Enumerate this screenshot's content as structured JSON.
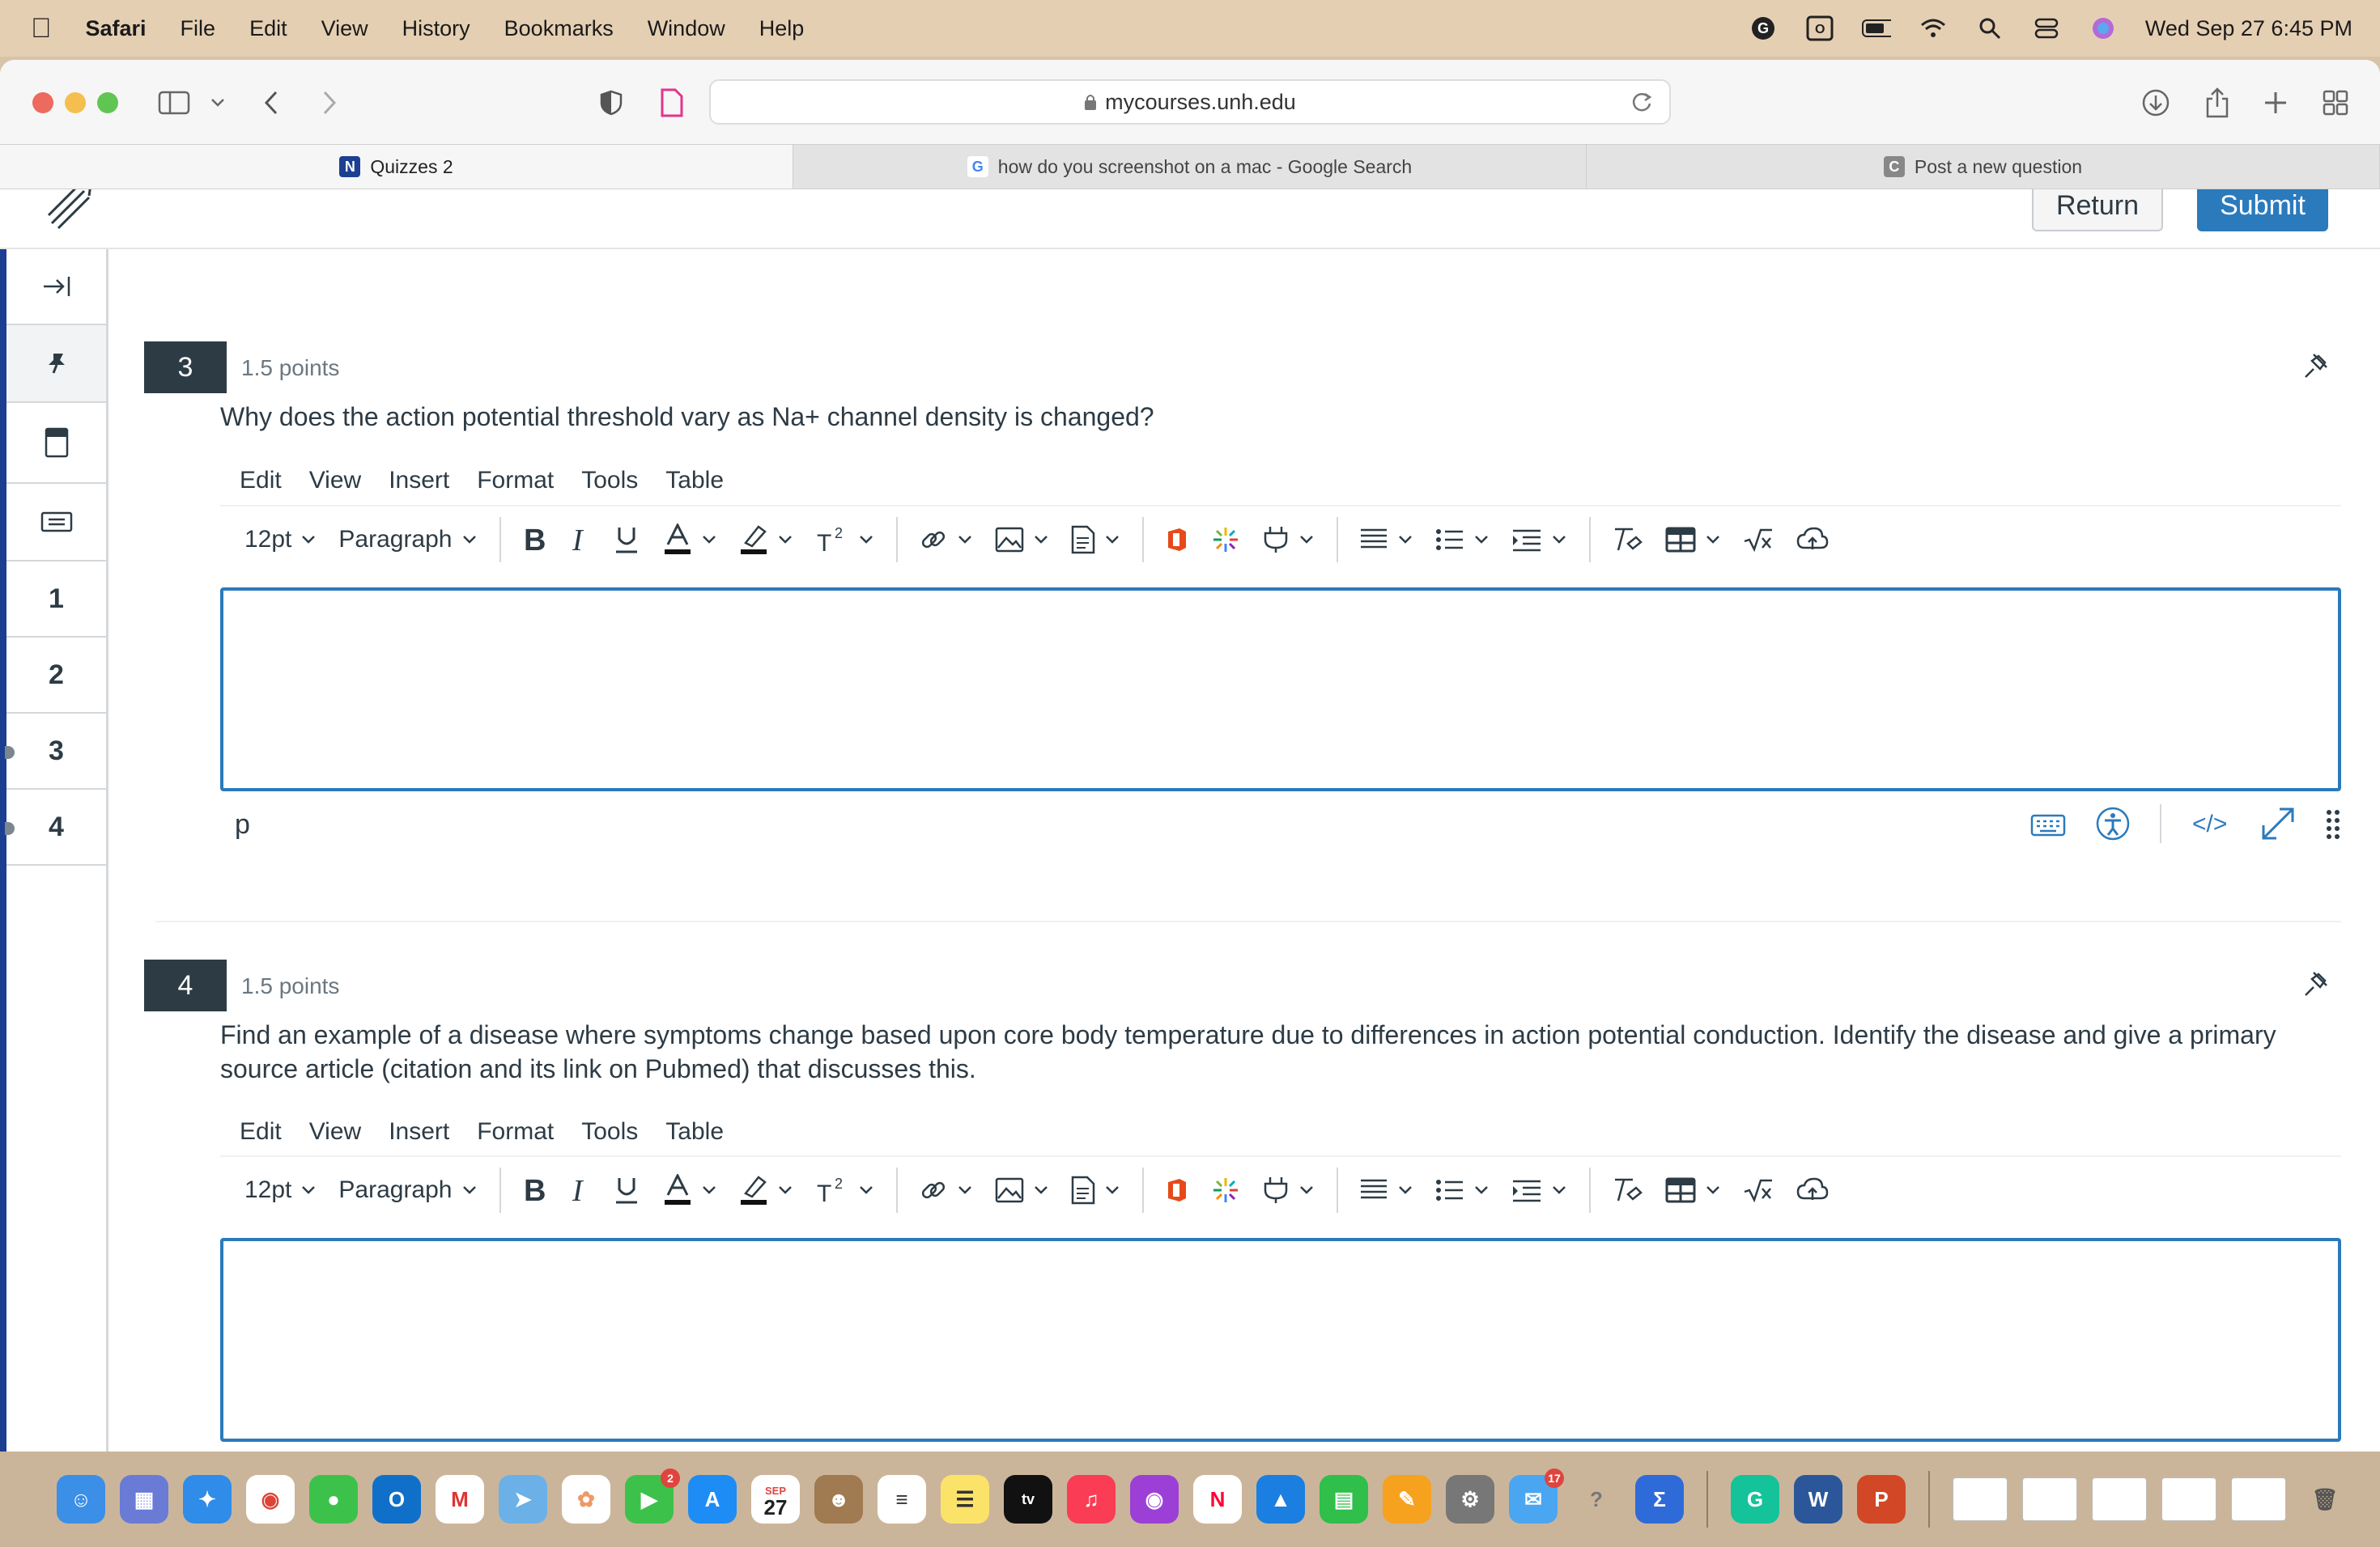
{
  "menubar": {
    "app_name": "Safari",
    "items": [
      "File",
      "Edit",
      "View",
      "History",
      "Bookmarks",
      "Window",
      "Help"
    ],
    "clock": "Wed Sep 27  6:45 PM"
  },
  "browser": {
    "url": "mycourses.unh.edu",
    "tabs": [
      {
        "label": "Quizzes 2",
        "favicon": "UNH"
      },
      {
        "label": "how do you screenshot on a mac - Google Search",
        "favicon": "G"
      },
      {
        "label": "Post a new question",
        "favicon": "C"
      }
    ]
  },
  "page": {
    "return_label": "Return",
    "submit_label": "Submit"
  },
  "nav": {
    "numbers": [
      "1",
      "2",
      "3",
      "4"
    ]
  },
  "editor": {
    "menu": [
      "Edit",
      "View",
      "Insert",
      "Format",
      "Tools",
      "Table"
    ],
    "font_size": "12pt",
    "block_format": "Paragraph",
    "status_path": "p"
  },
  "questions": [
    {
      "number": "3",
      "points": "1.5 points",
      "text": "Why does the action potential threshold vary as Na+ channel density is changed?"
    },
    {
      "number": "4",
      "points": "1.5 points",
      "text": "Find an example of a disease where symptoms change based upon core body temperature due to differences in action potential conduction. Identify the disease and give a primary source article (citation and its link on Pubmed) that discusses this."
    }
  ],
  "dock": {
    "calendar_month": "SEP",
    "calendar_day": "27",
    "facetime_badge": "2",
    "mail_badge": "17"
  }
}
